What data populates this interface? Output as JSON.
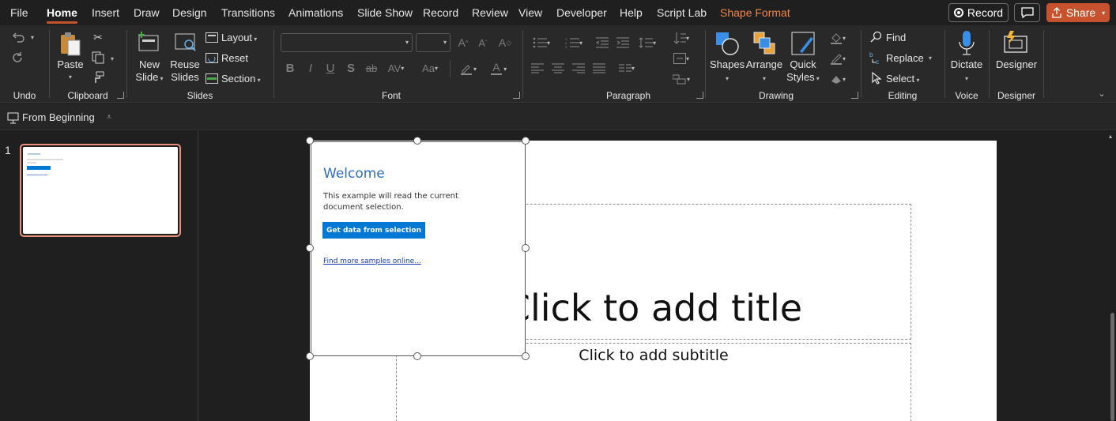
{
  "menu": {
    "items": [
      "File",
      "Home",
      "Insert",
      "Draw",
      "Design",
      "Transitions",
      "Animations",
      "Slide Show",
      "Record",
      "Review",
      "View",
      "Developer",
      "Help",
      "Script Lab"
    ],
    "context_tab": "Shape Format",
    "record_button": "Record",
    "share_button": "Share"
  },
  "ribbon": {
    "undo_group": "Undo",
    "clipboard": {
      "paste": "Paste",
      "label": "Clipboard"
    },
    "slides": {
      "new_slide_1": "New",
      "new_slide_2": "Slide",
      "reuse_1": "Reuse",
      "reuse_2": "Slides",
      "layout": "Layout",
      "reset": "Reset",
      "section": "Section",
      "label": "Slides"
    },
    "font": {
      "bold": "B",
      "italic": "I",
      "underline": "U",
      "shadow": "S",
      "strike": "ab",
      "label": "Font"
    },
    "paragraph": {
      "label": "Paragraph"
    },
    "drawing": {
      "shapes": "Shapes",
      "arrange": "Arrange",
      "quick_1": "Quick",
      "quick_2": "Styles",
      "label": "Drawing"
    },
    "editing": {
      "find": "Find",
      "replace": "Replace",
      "select": "Select",
      "label": "Editing"
    },
    "voice": {
      "dictate": "Dictate",
      "label": "Voice"
    },
    "designer": {
      "designer": "Designer",
      "label": "Designer"
    }
  },
  "quickbar": {
    "from_beginning": "From Beginning"
  },
  "thumbnails": {
    "slide_number": "1"
  },
  "taskpane": {
    "title": "Welcome",
    "description": "This example will read the current document selection.",
    "button": "Get data from selection",
    "link": "Find more samples online..."
  },
  "slide": {
    "title_placeholder": "Click to add title",
    "subtitle_placeholder": "Click to add subtitle"
  },
  "colors": {
    "accent": "#c6532e",
    "context_tab": "#f0864a",
    "addin_blue": "#0078d4",
    "title_blue": "#2f6dbd"
  }
}
